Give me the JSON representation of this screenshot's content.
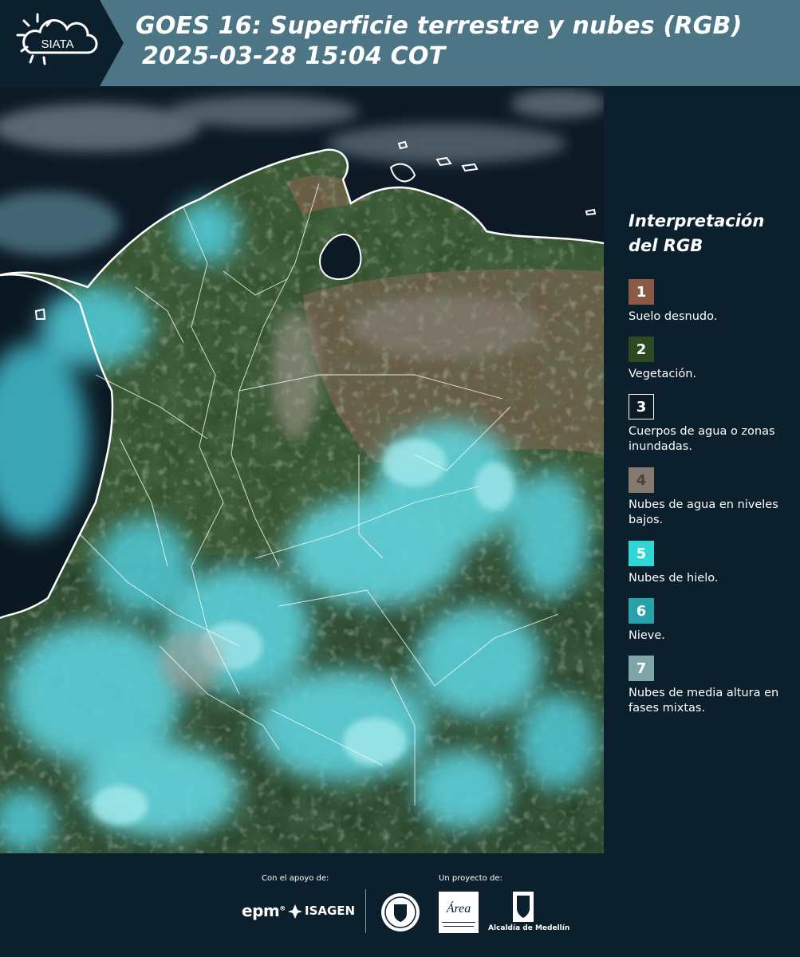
{
  "header": {
    "logo_text": "SIATA",
    "title_line1": "GOES 16: Superficie terrestre y nubes (RGB)",
    "title_line2": "2025-03-28 15:04 COT",
    "background_color": "#4c7585"
  },
  "legend": {
    "title_line1": "Interpretación",
    "title_line2": "del RGB",
    "items": [
      {
        "number": "1",
        "label": "Suelo desnudo.",
        "color": "#8a5a44"
      },
      {
        "number": "2",
        "label": "Vegetación.",
        "color": "#2d4a22"
      },
      {
        "number": "3",
        "label": "Cuerpos de agua o zonas inundadas.",
        "color": "#0b1a24"
      },
      {
        "number": "4",
        "label": "Nubes de agua en niveles bajos.",
        "color": "#857a70"
      },
      {
        "number": "5",
        "label": "Nubes de hielo.",
        "color": "#2ed6d6"
      },
      {
        "number": "6",
        "label": "Nieve.",
        "color": "#26a3a8"
      },
      {
        "number": "7",
        "label": "Nubes de media altura en fases mixtas.",
        "color": "#7ea6a8"
      }
    ]
  },
  "footer": {
    "support_label": "Con el apoyo de:",
    "project_label": "Un proyecto de:",
    "sponsor_1": "epm",
    "sponsor_2": "ISAGEN",
    "partner_1": "Medellín seal",
    "partner_2": "Área Metropolitana Valle de Aburrá",
    "partner_3": "Alcaldía de Medellín"
  },
  "icons": {
    "logo": "siata-sun-cloud-logo",
    "seal": "medellin-seal-icon",
    "area": "area-metropolitana-logo",
    "alcaldia": "alcaldia-shield-icon"
  }
}
